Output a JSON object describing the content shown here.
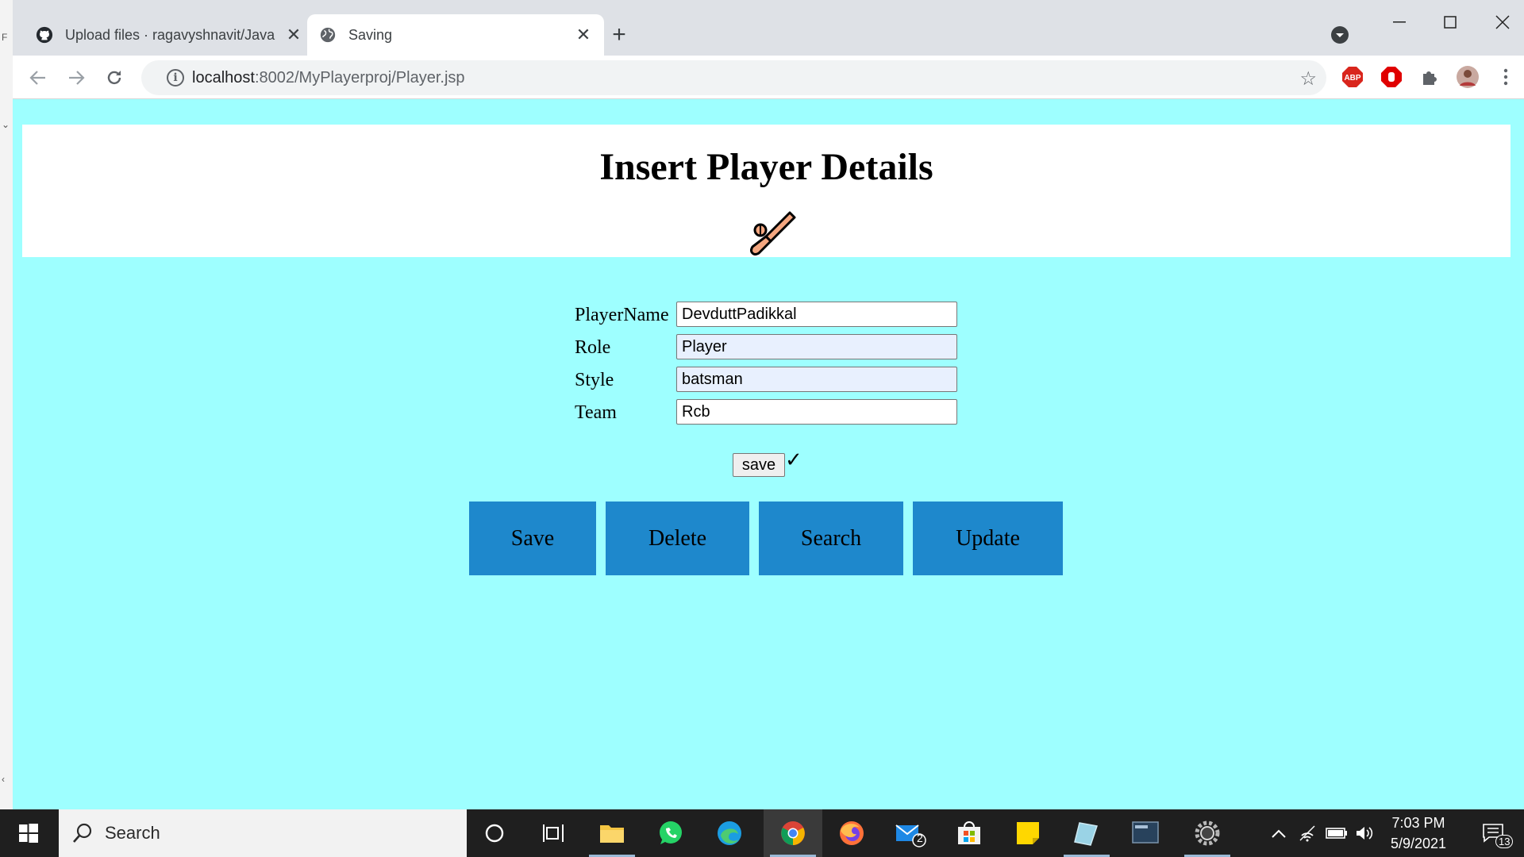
{
  "browser": {
    "tabs": [
      {
        "title": "Upload files · ragavyshnavit/Java",
        "favicon": "github-icon",
        "active": false
      },
      {
        "title": "Saving",
        "favicon": "globe-icon",
        "active": true
      }
    ],
    "address": {
      "host": "localhost",
      "path": ":8002/MyPlayerproj/Player.jsp"
    },
    "extensions": [
      "adblock-plus-icon",
      "stop-hand-icon",
      "puzzle-icon",
      "profile-avatar"
    ]
  },
  "page": {
    "heading": "Insert Player Details",
    "form": {
      "fields": [
        {
          "label": "PlayerName",
          "value": "DevduttPadikkal"
        },
        {
          "label": "Role",
          "value": "Player"
        },
        {
          "label": "Style",
          "value": "batsman"
        },
        {
          "label": "Team",
          "value": "Rcb"
        }
      ],
      "submit_label": "save",
      "check_mark": "✓"
    },
    "actions": [
      "Save",
      "Delete",
      "Search",
      "Update"
    ],
    "colors": {
      "background": "#9effff",
      "button": "#1e88cc"
    }
  },
  "taskbar": {
    "search_placeholder": "Search",
    "mail_badge": "2",
    "time": "7:03 PM",
    "date": "5/9/2021",
    "notification_count": "13"
  }
}
